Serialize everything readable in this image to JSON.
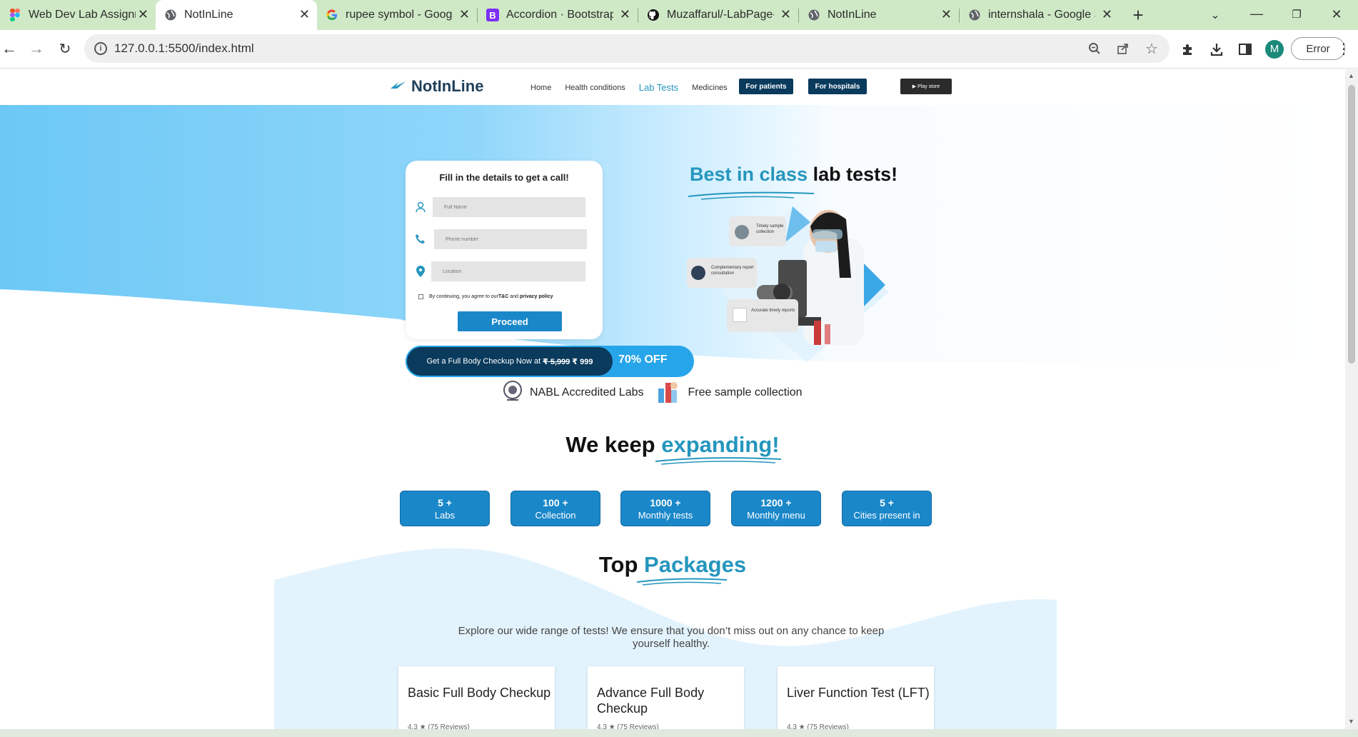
{
  "browser": {
    "tabs": [
      {
        "title": "Web Dev Lab Assignm",
        "icon": "figma-icon"
      },
      {
        "title": "NotInLine",
        "icon": "globe-icon",
        "active": true
      },
      {
        "title": "rupee symbol - Goog",
        "icon": "google-icon"
      },
      {
        "title": "Accordion · Bootstrap",
        "icon": "bootstrap-icon"
      },
      {
        "title": "Muzaffarul/-LabPage-",
        "icon": "github-icon"
      },
      {
        "title": "NotInLine",
        "icon": "globe-icon"
      },
      {
        "title": "internshala - Google S",
        "icon": "globe-icon"
      }
    ],
    "url": "127.0.0.1:5500/index.html",
    "profile_initial": "M",
    "error_label": "Error"
  },
  "site": {
    "logo": "NotInLine",
    "nav": {
      "home": "Home",
      "health": "Health conditions",
      "lab_tests": "Lab Tests",
      "medicines": "Medicines",
      "for_patients": "For patients",
      "for_hospitals": "For hospitals",
      "play_store": "▶ Play store"
    },
    "form": {
      "title": "Fill in the details to get a call!",
      "name_placeholder": "Full Name",
      "phone_placeholder": "Phone number",
      "location_placeholder": "Location",
      "terms_prefix": "By continuing, you agree to our ",
      "terms_tc": "T&C",
      "terms_and": " and ",
      "terms_privacy": "privacy policy",
      "proceed": "Proceed"
    },
    "offer": {
      "text": "Get a Full Body Checkup Now at",
      "old_price": "₹ 5,999",
      "new_price": "₹ 999",
      "discount": "70% OFF"
    },
    "hero_title": {
      "highlight": "Best in class",
      "rest": " lab tests!"
    },
    "hero_badges": {
      "sample": "Timely sample collection",
      "consult": "Complementary report consultation",
      "reports": "Accurate timely reports"
    },
    "features": {
      "nabl": "NABL Accredited Labs",
      "sample": "Free sample collection"
    },
    "expanding": {
      "prefix": "We keep ",
      "highlight": "expanding!"
    },
    "stats": [
      {
        "value": "5 +",
        "label": "Labs"
      },
      {
        "value": "100 +",
        "label": "Collection"
      },
      {
        "value": "1000 +",
        "label": "Monthly tests"
      },
      {
        "value": "1200 +",
        "label": "Monthly menu"
      },
      {
        "value": "5 +",
        "label": "Cities present in"
      }
    ],
    "packages": {
      "prefix": "Top ",
      "highlight": "Packages",
      "subtitle": "Explore our wide range of tests! We ensure that you don’t miss out on any chance to keep yourself healthy.",
      "items": [
        {
          "name": "Basic Full Body Checkup",
          "reviews": "4.3 ★ (75 Reviews)"
        },
        {
          "name": "Advance Full Body Checkup",
          "reviews": "4.3 ★ (75 Reviews)"
        },
        {
          "name": "Liver Function Test (LFT)",
          "reviews": "4.3 ★ (75 Reviews)"
        }
      ]
    }
  },
  "colors": {
    "accent": "#2596be",
    "dark": "#0a3a5c",
    "hero_blue": "#6cc8f5",
    "button": "#1a87c9"
  }
}
